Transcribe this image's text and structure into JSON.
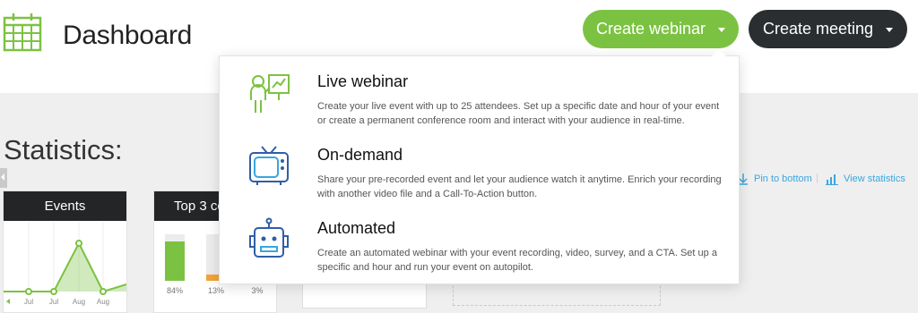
{
  "header": {
    "title": "Dashboard",
    "create_webinar_label": "Create webinar",
    "create_meeting_label": "Create meeting"
  },
  "colors": {
    "green": "#7cc242",
    "dark": "#2b2e30",
    "blue": "#39a6df",
    "orange": "#f2a33a"
  },
  "dropdown": {
    "items": [
      {
        "title": "Live webinar",
        "icon": "presenter-icon",
        "description": "Create your live event with up to 25 attendees. Set up a specific date and hour of your event or create a permanent conference room and interact with your audience in real-time."
      },
      {
        "title": "On-demand",
        "icon": "tv-icon",
        "description": "Share your pre-recorded event and let your audience watch it anytime. Enrich your recording with another video file and a Call-To-Action button."
      },
      {
        "title": "Automated",
        "icon": "robot-icon",
        "description": "Create an automated webinar with your event recording, video, survey, and a CTA. Set up a specific and hour and run your event on autopilot."
      }
    ]
  },
  "statistics": {
    "title": "Statistics:",
    "pin_label": "Pin to bottom",
    "view_label": "View statistics",
    "events_card": {
      "title": "Events",
      "x_labels": [
        "Jul",
        "Jul",
        "Aug",
        "Aug"
      ]
    },
    "top3_card": {
      "title": "Top 3 co",
      "bars": [
        {
          "label": "84%",
          "value": 0.84,
          "color": "#7cc242"
        },
        {
          "label": "13%",
          "value": 0.13,
          "color": "#f2a33a"
        },
        {
          "label": "3%",
          "value": 0.03,
          "color": "#39a6df"
        }
      ]
    }
  }
}
